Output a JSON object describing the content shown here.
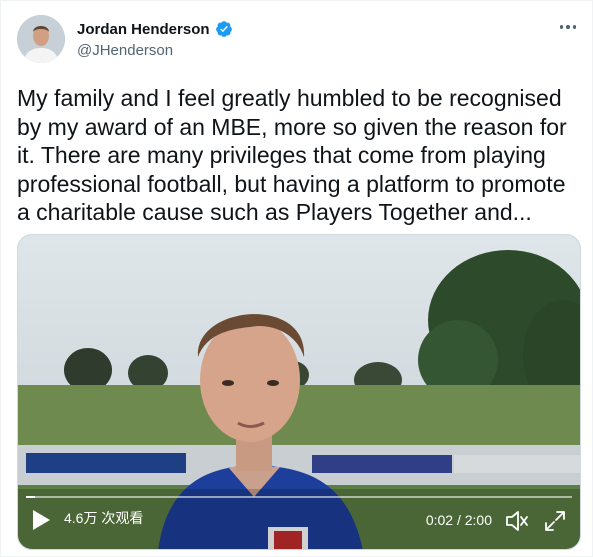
{
  "author": {
    "display_name": "Jordan Henderson",
    "handle": "@JHenderson",
    "verified": true,
    "icons": [
      "avatar",
      "verified-badge-icon",
      "more-options-icon"
    ]
  },
  "tweet": {
    "text": "My family and I feel greatly humbled to be recognised\nby my award of an MBE, more so given the reason for\nit. There are many privileges that come from playing\nprofessional football, but having a platform to promote\na charitable cause such as Players Together and..."
  },
  "video": {
    "views": "4.6万 次观看",
    "time": "0:02 / 2:00",
    "progress_fraction": 0.017,
    "icons": [
      "play-icon",
      "volume-icon",
      "fullscreen-icon"
    ]
  },
  "colors": {
    "verified_blue": "#1d9bf0",
    "text_primary": "#0f1419",
    "text_secondary": "#536471"
  }
}
